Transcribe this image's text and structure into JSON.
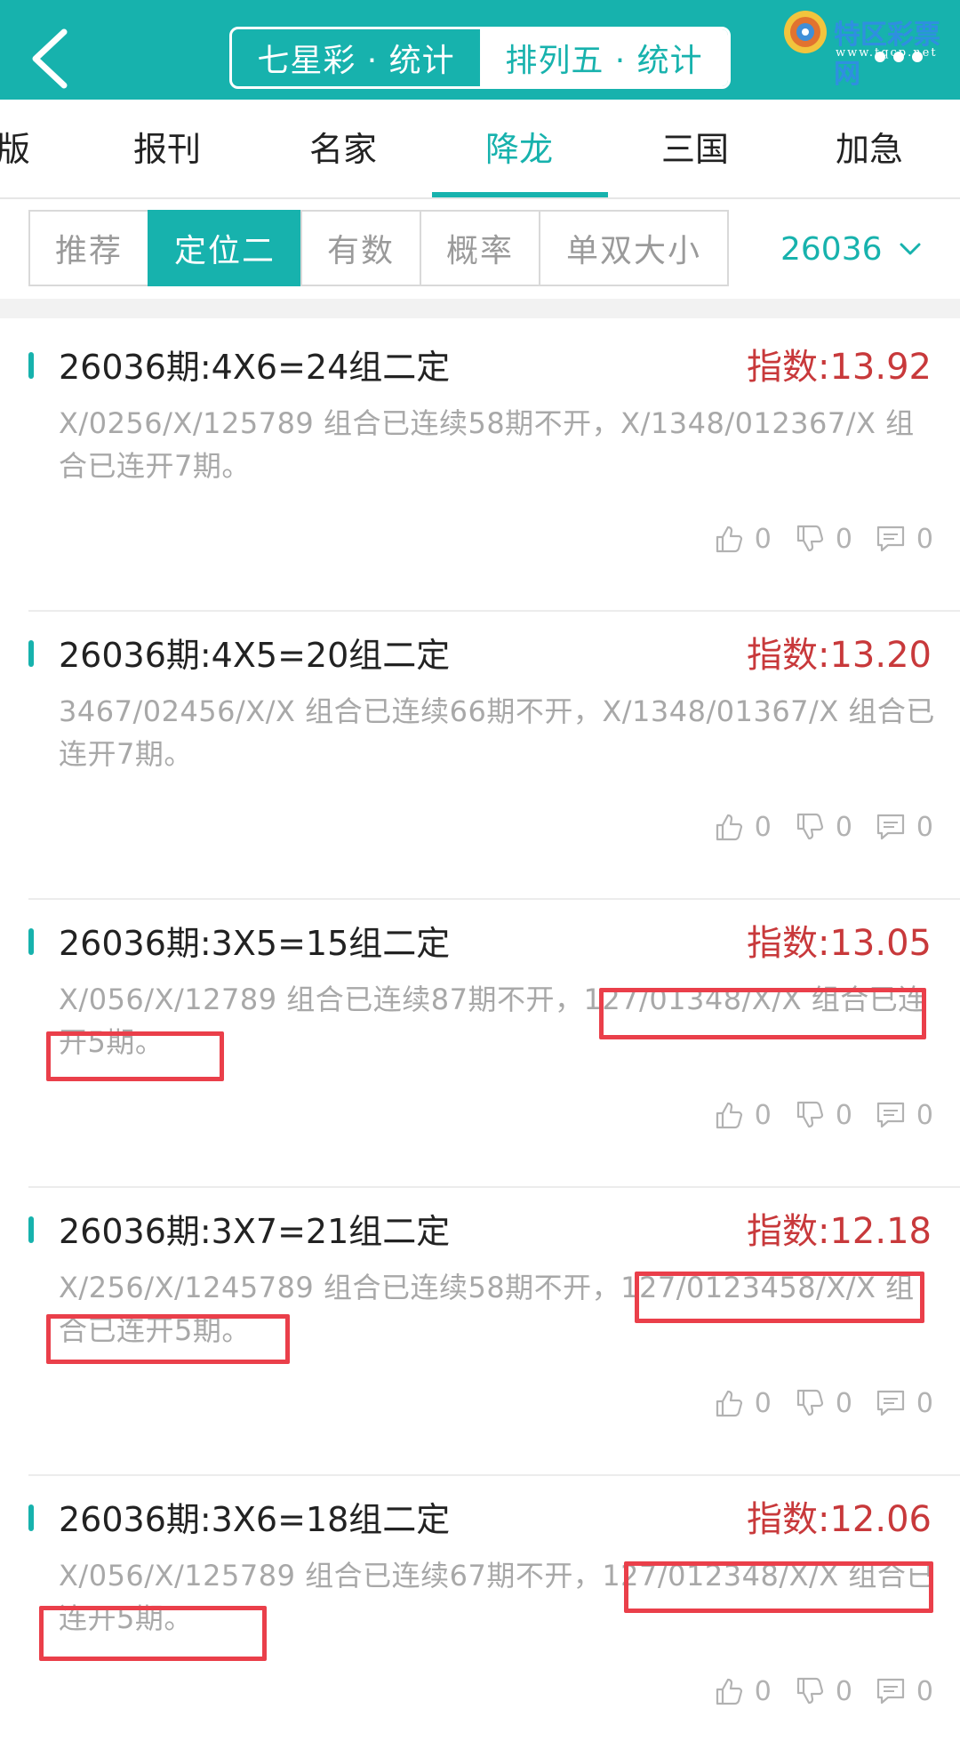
{
  "header": {
    "segments": [
      {
        "label": "七星彩 · 统计",
        "active": false
      },
      {
        "label": "排列五 · 统计",
        "active": true
      }
    ],
    "brand_name": "特区彩票网",
    "brand_url": "www.tqcp.net"
  },
  "tabs": [
    {
      "label": "版",
      "active": false
    },
    {
      "label": "报刊",
      "active": false
    },
    {
      "label": "名家",
      "active": false
    },
    {
      "label": "降龙",
      "active": true
    },
    {
      "label": "三国",
      "active": false
    },
    {
      "label": "加急",
      "active": false
    }
  ],
  "filters": [
    {
      "label": "推荐",
      "active": false
    },
    {
      "label": "定位二",
      "active": true
    },
    {
      "label": "有数",
      "active": false
    },
    {
      "label": "概率",
      "active": false
    },
    {
      "label": "单双大小",
      "active": false
    }
  ],
  "issue_selector": {
    "value": "26036"
  },
  "cards": [
    {
      "title": "26036期:4X6=24组二定",
      "index": "指数:13.92",
      "desc": "X/0256/X/125789 组合已连续58期不开，X/1348/012367/X 组合已连开7期。",
      "likes": "0",
      "dislikes": "0",
      "comments": "0"
    },
    {
      "title": "26036期:4X5=20组二定",
      "index": "指数:13.20",
      "desc": "3467/02456/X/X 组合已连续66期不开，X/1348/01367/X 组合已连开7期。",
      "likes": "0",
      "dislikes": "0",
      "comments": "0"
    },
    {
      "title": "26036期:3X5=15组二定",
      "index": "指数:13.05",
      "desc": "X/056/X/12789 组合已连续87期不开，127/01348/X/X 组合已连开5期。",
      "likes": "0",
      "dislikes": "0",
      "comments": "0"
    },
    {
      "title": "26036期:3X7=21组二定",
      "index": "指数:12.18",
      "desc": "X/256/X/1245789 组合已连续58期不开，127/0123458/X/X 组合已连开5期。",
      "likes": "0",
      "dislikes": "0",
      "comments": "0"
    },
    {
      "title": "26036期:3X6=18组二定",
      "index": "指数:12.06",
      "desc": "X/056/X/125789 组合已连续67期不开，127/012348/X/X 组合已连开5期。",
      "likes": "0",
      "dislikes": "0",
      "comments": "0"
    }
  ],
  "colors": {
    "accent": "#17b2ad",
    "index_red": "#c8393b",
    "highlight_box": "#ea3f4a"
  }
}
